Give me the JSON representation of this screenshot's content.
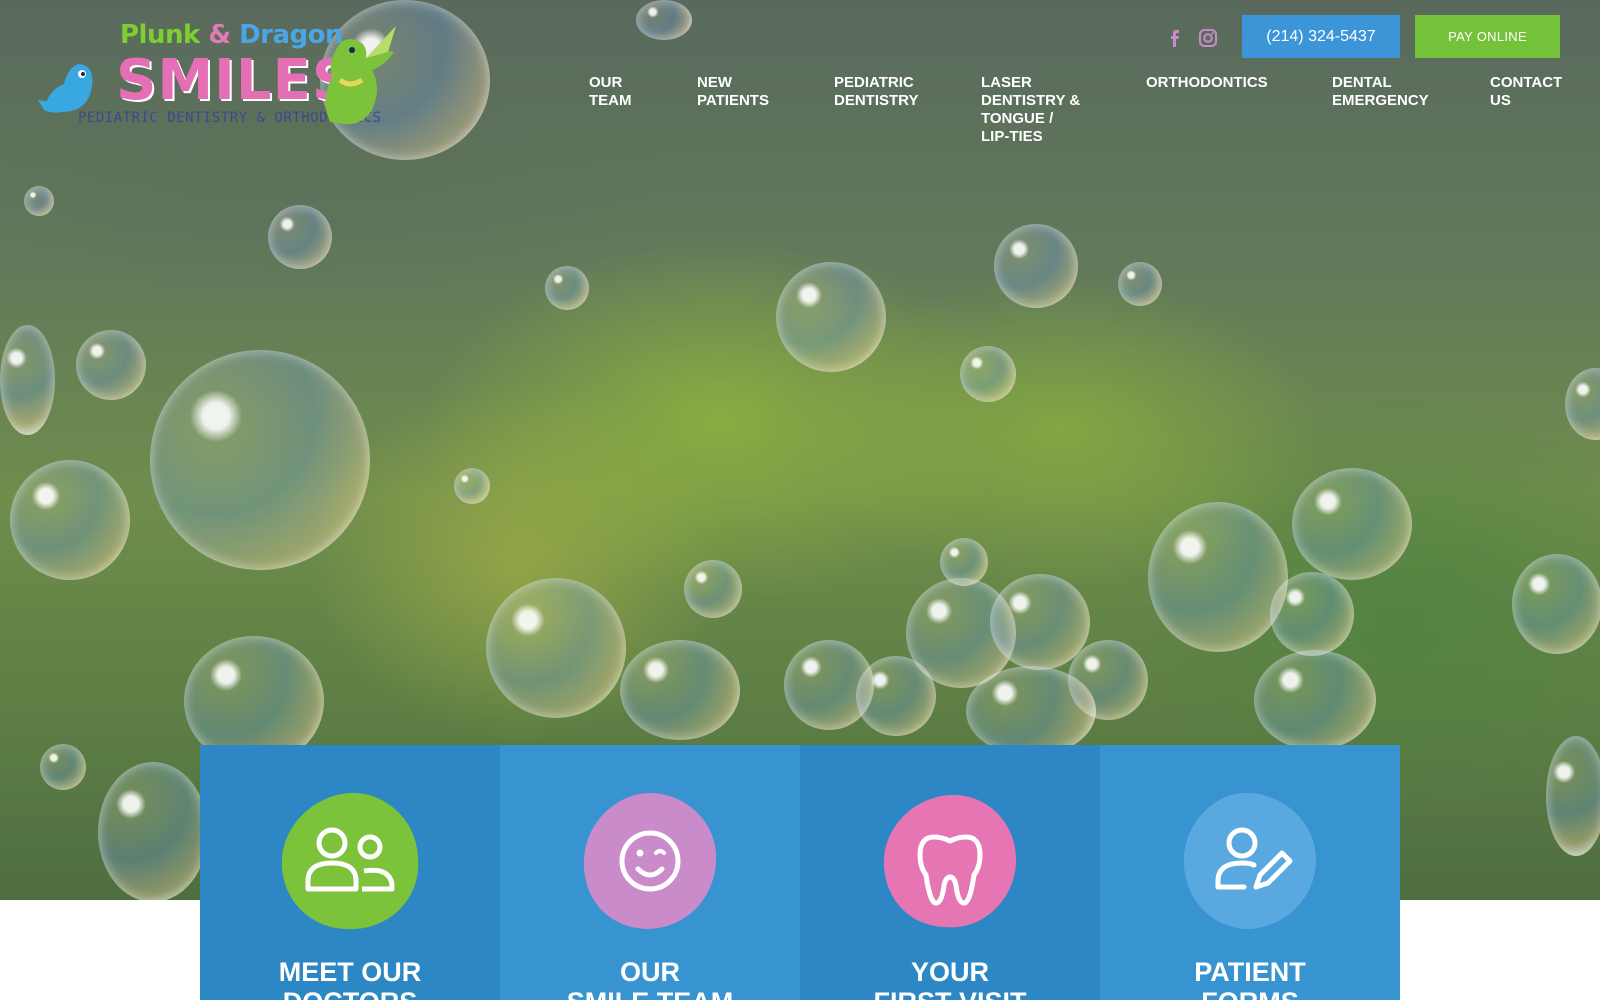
{
  "logo": {
    "brand_top_1": "Plunk",
    "brand_amp": "&",
    "brand_top_2": "Dragon",
    "brand_main": "SMILES",
    "brand_sub": "PEDIATRIC DENTISTRY & ORTHODONTICS"
  },
  "header": {
    "social": [
      {
        "icon": "facebook-icon"
      },
      {
        "icon": "instagram-icon"
      }
    ],
    "phone_label": "(214) 324-5437",
    "pay_label": "PAY ONLINE"
  },
  "nav": [
    {
      "label": "OUR\nTEAM"
    },
    {
      "label": "NEW\nPATIENTS"
    },
    {
      "label": "PEDIATRIC\nDENTISTRY"
    },
    {
      "label": "LASER\nDENTISTRY &\nTONGUE /\nLIP-TIES"
    },
    {
      "label": "ORTHODONTICS"
    },
    {
      "label": "DENTAL\nEMERGENCY"
    },
    {
      "label": "CONTACT\nUS"
    }
  ],
  "cards": [
    {
      "title": "MEET OUR\nDOCTORS",
      "icon": "users-icon",
      "color": "#7cc23a"
    },
    {
      "title": "OUR\nSMILE TEAM",
      "icon": "wink-smiley-icon",
      "color": "#c98bc9"
    },
    {
      "title": "YOUR\nFIRST VISIT",
      "icon": "tooth-icon",
      "color": "#e676b3"
    },
    {
      "title": "PATIENT\nFORMS",
      "icon": "user-edit-icon",
      "color": "#5aa8e0"
    }
  ],
  "colors": {
    "phone_button": "#3b95d6",
    "pay_button": "#73c23a",
    "card_background": "#2c87c4",
    "social_icon": "#c98bc9"
  }
}
